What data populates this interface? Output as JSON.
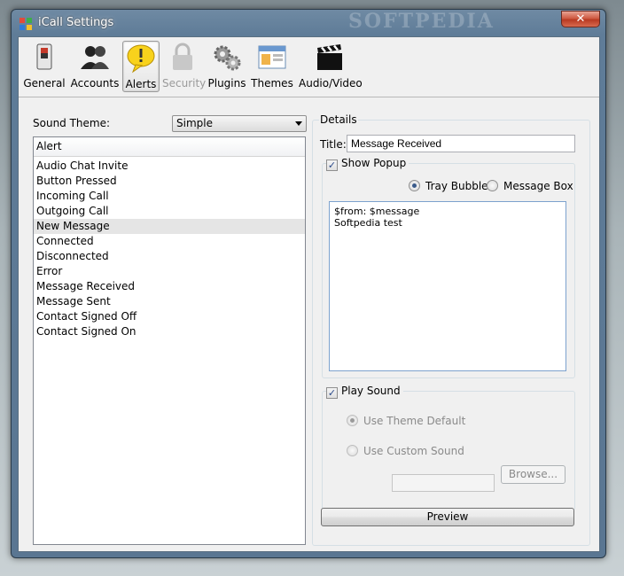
{
  "window": {
    "title": "iCall Settings",
    "watermark": "SOFTPEDIA",
    "close_label": "✕"
  },
  "toolbar": {
    "items": [
      {
        "label": "General",
        "icon": "switch-icon",
        "active": false,
        "disabled": false
      },
      {
        "label": "Accounts",
        "icon": "users-icon",
        "active": false,
        "disabled": false
      },
      {
        "label": "Alerts",
        "icon": "speech-bubble-alert-icon",
        "active": true,
        "disabled": false
      },
      {
        "label": "Security",
        "icon": "padlock-icon",
        "active": false,
        "disabled": true
      },
      {
        "label": "Plugins",
        "icon": "gears-icon",
        "active": false,
        "disabled": false
      },
      {
        "label": "Themes",
        "icon": "window-theme-icon",
        "active": false,
        "disabled": false
      },
      {
        "label": "Audio/Video",
        "icon": "clapperboard-icon",
        "active": false,
        "disabled": false
      }
    ]
  },
  "left": {
    "sound_theme_label": "Sound Theme:",
    "sound_theme_value": "Simple",
    "list_header": "Alert",
    "items": [
      "Audio Chat Invite",
      "Button Pressed",
      "Incoming Call",
      "Outgoing Call",
      "New Message",
      "Connected",
      "Disconnected",
      "Error",
      "Message Received",
      "Message Sent",
      "Contact Signed Off",
      "Contact Signed On"
    ],
    "selected_index": 4
  },
  "details": {
    "legend": "Details",
    "title_label": "Title:",
    "title_value": "Message Received",
    "show_popup_label": "Show Popup",
    "show_popup_checked": true,
    "tray_bubble_label": "Tray Bubble",
    "message_box_label": "Message Box",
    "popup_text": "$from: $message\nSoftpedia test",
    "play_sound_label": "Play Sound",
    "play_sound_checked": true,
    "use_theme_default_label": "Use Theme Default",
    "use_custom_sound_label": "Use Custom Sound",
    "browse_label": "Browse...",
    "preview_label": "Preview"
  }
}
